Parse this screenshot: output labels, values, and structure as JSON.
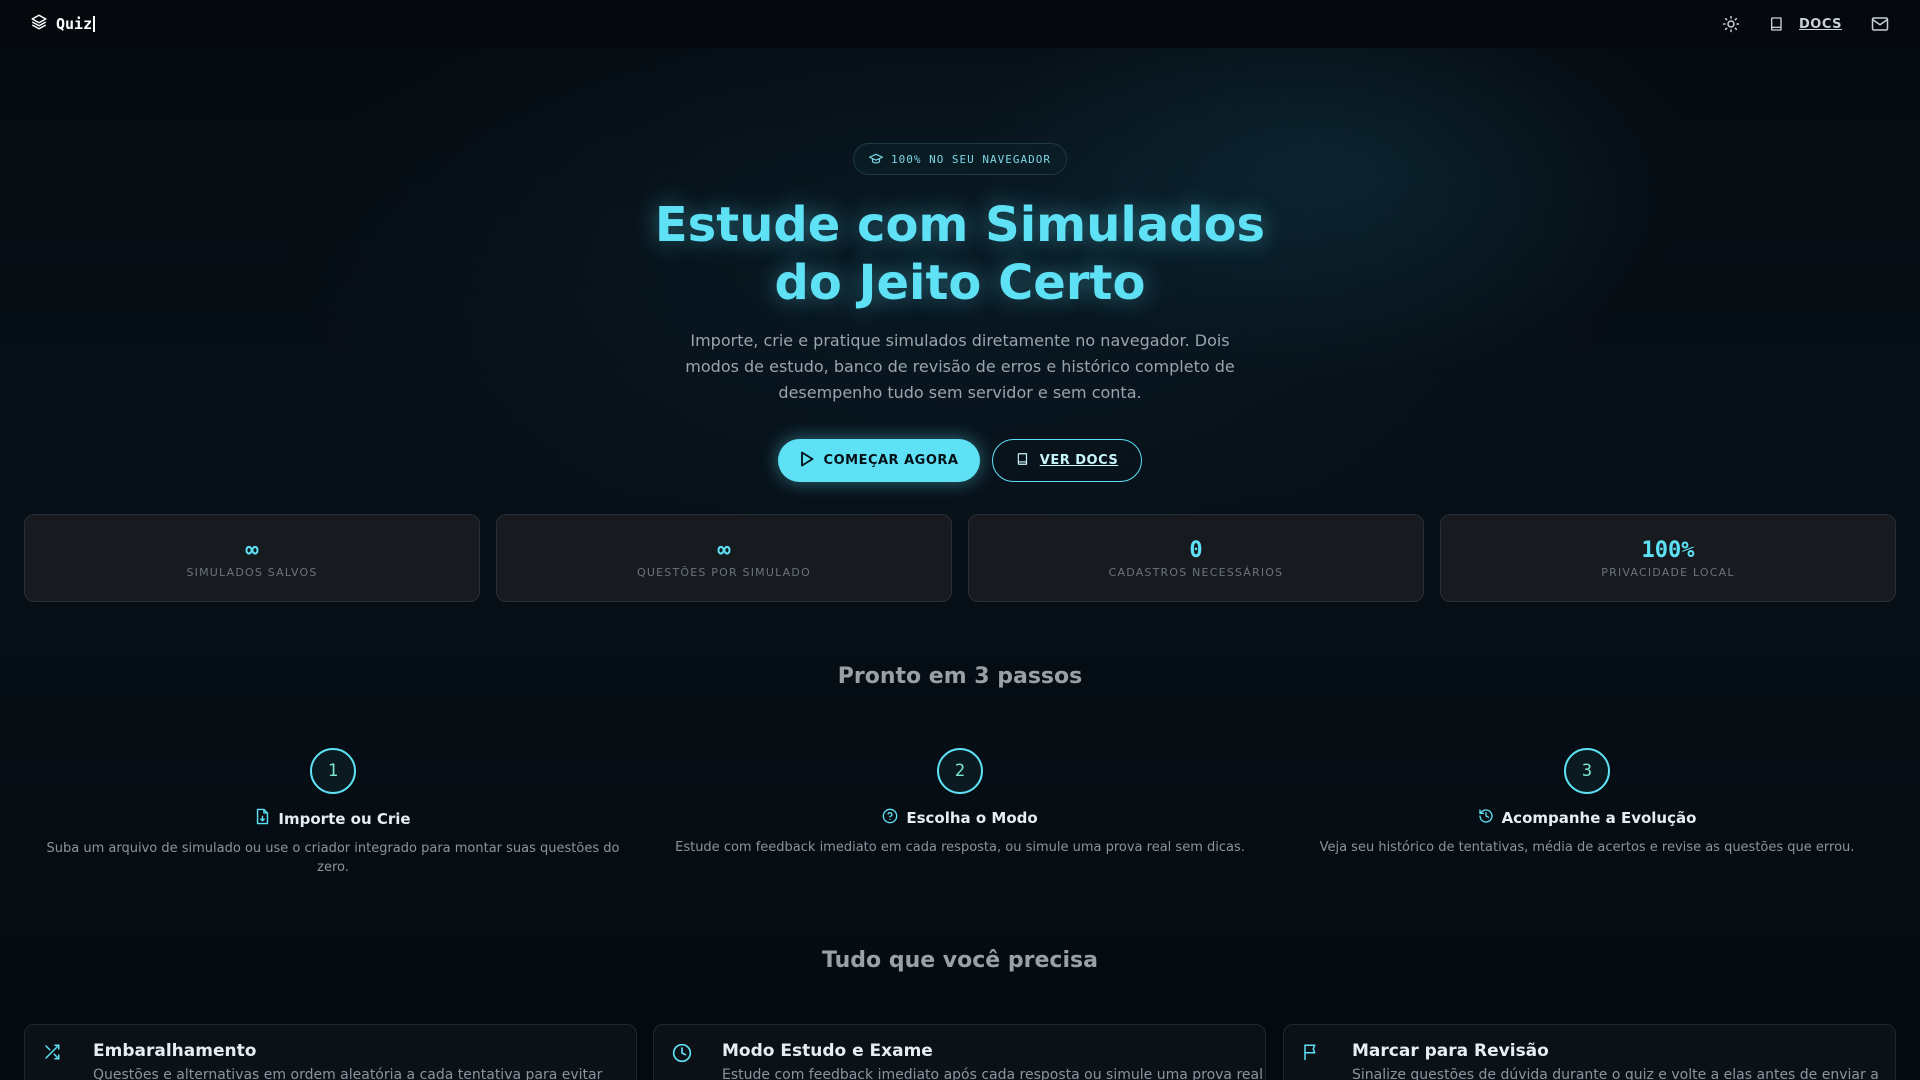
{
  "nav": {
    "brand": "Quiz",
    "docs_label": "DOCS"
  },
  "hero": {
    "badge": "100% NO SEU NAVEGADOR",
    "title_line1": "Estude com Simulados",
    "title_line2": "do Jeito Certo",
    "subtitle": "Importe, crie e pratique simulados diretamente no navegador. Dois modos de estudo, banco de revisão de erros e histórico completo de desempenho tudo sem servidor e sem conta.",
    "primary_cta": "COMEÇAR AGORA",
    "secondary_cta": "VER DOCS"
  },
  "stats": [
    {
      "value": "∞",
      "label": "SIMULADOS SALVOS"
    },
    {
      "value": "∞",
      "label": "QUESTÕES POR SIMULADO"
    },
    {
      "value": "0",
      "label": "CADASTROS NECESSÁRIOS"
    },
    {
      "value": "100%",
      "label": "PRIVACIDADE LOCAL"
    }
  ],
  "steps_section": {
    "title": "Pronto em 3 passos",
    "steps": [
      {
        "number": "1",
        "title": "Importe ou Crie",
        "icon": "file-import-icon",
        "desc": "Suba um arquivo de simulado ou use o criador integrado para montar suas questões do zero."
      },
      {
        "number": "2",
        "title": "Escolha o Modo",
        "icon": "help-circle-icon",
        "desc": "Estude com feedback imediato em cada resposta, ou simule uma prova real sem dicas."
      },
      {
        "number": "3",
        "title": "Acompanhe a Evolução",
        "icon": "history-icon",
        "desc": "Veja seu histórico de tentativas, média de acertos e revise as questões que errou."
      }
    ]
  },
  "features_section": {
    "title": "Tudo que você precisa",
    "features": [
      {
        "title": "Embaralhamento",
        "icon": "shuffle-icon",
        "desc": "Questões e alternativas em ordem aleatória a cada tentativa para evitar"
      },
      {
        "title": "Modo Estudo e Exame",
        "icon": "clock-icon",
        "desc": "Estude com feedback imediato após cada resposta ou simule uma prova real"
      },
      {
        "title": "Marcar para Revisão",
        "icon": "flag-icon",
        "desc": "Sinalize questões de dúvida durante o quiz e volte a elas antes de enviar a"
      }
    ]
  },
  "colors": {
    "accent": "#5ee0f5",
    "background": "#060b10",
    "card": "#171a1e"
  }
}
